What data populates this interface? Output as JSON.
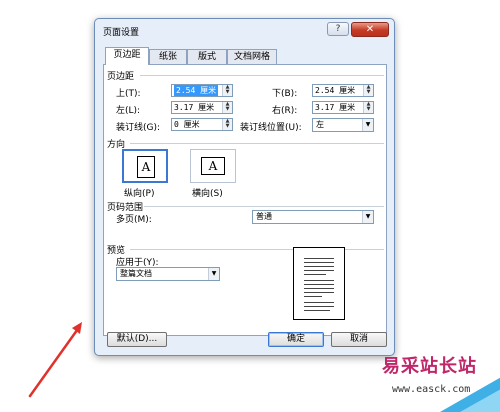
{
  "dialog": {
    "title": "页面设置",
    "help_label": "?",
    "close_label": "✕"
  },
  "tabs": [
    {
      "label": "页边距",
      "active": true
    },
    {
      "label": "纸张",
      "active": false
    },
    {
      "label": "版式",
      "active": false
    },
    {
      "label": "文档网格",
      "active": false
    }
  ],
  "margins": {
    "section_label": "页边距",
    "top_label": "上(T):",
    "top_value": "2.54 厘米",
    "bottom_label": "下(B):",
    "bottom_value": "2.54 厘米",
    "left_label": "左(L):",
    "left_value": "3.17 厘米",
    "right_label": "右(R):",
    "right_value": "3.17 厘米",
    "gutter_label": "装订线(G):",
    "gutter_value": "0 厘米",
    "gutter_pos_label": "装订线位置(U):",
    "gutter_pos_value": "左"
  },
  "orientation": {
    "section_label": "方向",
    "portrait_label": "纵向(P)",
    "landscape_label": "横向(S)",
    "icon_letter": "A"
  },
  "pages": {
    "section_label": "页码范围",
    "multiple_label": "多页(M):",
    "multiple_value": "普通"
  },
  "preview": {
    "section_label": "预览",
    "apply_label": "应用于(Y):",
    "apply_value": "整篇文档"
  },
  "footer": {
    "default_label": "默认(D)...",
    "ok_label": "确定",
    "cancel_label": "取消"
  },
  "watermark": {
    "site_name": "易采站长站",
    "url": "www.easck.com"
  },
  "colors": {
    "accent": "#3a78d4",
    "close_red": "#c43b25",
    "arrow_red": "#e0322b",
    "watermark_magenta": "#c0266a"
  }
}
